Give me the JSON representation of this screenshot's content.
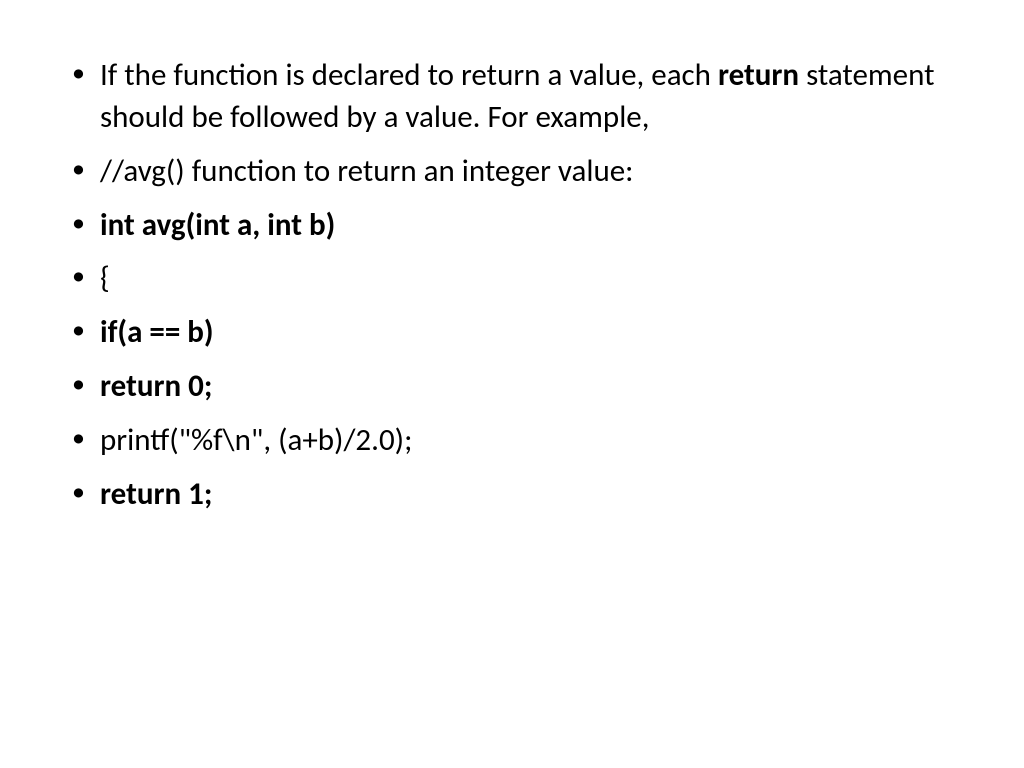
{
  "bullets": [
    {
      "segments": [
        {
          "text": "If the function is declared to return a value, each ",
          "bold": false
        },
        {
          "text": "return",
          "bold": true
        },
        {
          "text": " statement should be followed by a value. For example,",
          "bold": false
        }
      ]
    },
    {
      "segments": [
        {
          "text": "//avg() function to return an integer value:",
          "bold": false
        }
      ]
    },
    {
      "segments": [
        {
          "text": "int avg(int a, int b)",
          "bold": true
        }
      ]
    },
    {
      "segments": [
        {
          "text": "{",
          "bold": false
        }
      ]
    },
    {
      "segments": [
        {
          "text": "if(a == b)",
          "bold": true
        }
      ]
    },
    {
      "segments": [
        {
          "text": "return 0;",
          "bold": true
        }
      ]
    },
    {
      "segments": [
        {
          "text": "printf(\"%f\\n\", (a+b)/2.0);",
          "bold": false
        }
      ]
    },
    {
      "segments": [
        {
          "text": "return 1;",
          "bold": true
        }
      ]
    }
  ]
}
